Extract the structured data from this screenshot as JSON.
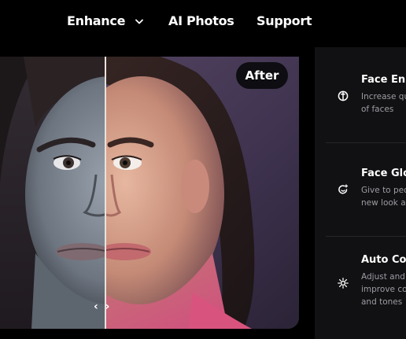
{
  "nav": {
    "items": [
      {
        "label": "Enhance"
      },
      {
        "label": "AI Photos"
      },
      {
        "label": "Support"
      }
    ]
  },
  "compare": {
    "badge": "After",
    "handle_glyph": "‹ ›"
  },
  "features": [
    {
      "title": "Face Enh",
      "desc": "Increase qu\nof faces",
      "icon": "face-enhance-icon"
    },
    {
      "title": "Face Glo",
      "desc": "Give to peo\nnew look ar",
      "icon": "face-glow-icon"
    },
    {
      "title": "Auto Co",
      "desc": "Adjust and\nimprove co\nand tones",
      "icon": "auto-color-icon"
    }
  ]
}
